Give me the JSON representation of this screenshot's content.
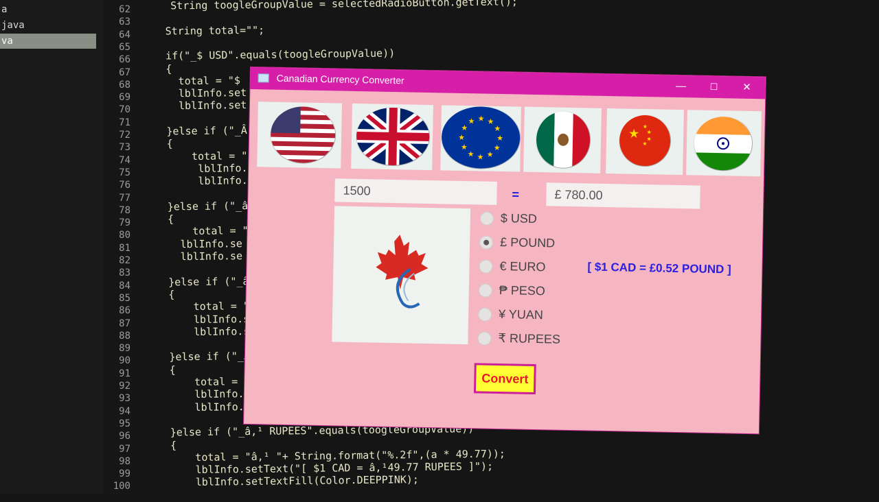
{
  "ide": {
    "files": [
      "a",
      "java",
      "va"
    ],
    "line_numbers": [
      "62",
      "63",
      "64",
      "65",
      "66",
      "67",
      "68",
      "69",
      "70",
      "71",
      "72",
      "73",
      "74",
      "75",
      "76",
      "77",
      "78",
      "79",
      "80",
      "81",
      "82",
      "83",
      "84",
      "85",
      "86",
      "87",
      "88",
      "89",
      "90",
      "91",
      "92",
      "93",
      "94",
      "95",
      "96",
      "97",
      "98",
      "99",
      "100"
    ],
    "code_lines": [
      "String toogleGroupValue = selectedRadioButton.getText();",
      "",
      "String total=\"\";",
      "",
      "if(\"_$ USD\".equals(toogleGroupValue))",
      "{",
      "  total = \"$",
      "  lblInfo.set",
      "  lblInfo.set",
      "",
      "}else if (\"_Â",
      "{",
      "    total = \"",
      "     lblInfo.",
      "     lblInfo.",
      "",
      "}else if (\"_â",
      "{",
      "    total = \"",
      "  lblInfo.se",
      "  lblInfo.se",
      "",
      "}else if (\"_â",
      "{",
      "    total = \"",
      "    lblInfo.s",
      "    lblInfo.s",
      "",
      "}else if (\"_Â",
      "{",
      "    total = \"",
      "    lblInfo.s",
      "    lblInfo.s",
      "",
      "}else if (\"_â,¹ RUPEES\".equals(toogleGroupValue))",
      "{",
      "    total = \"â,¹ \"+ String.format(\"%.2f\",(a * 49.77));",
      "    lblInfo.setText(\"[ $1 CAD = â,¹49.77 RUPEES ]\");",
      "    lblInfo.setTextFill(Color.DEEPPINK);"
    ]
  },
  "window": {
    "title": "Canadian Currency Converter",
    "controls": {
      "minimize": "—",
      "maximize": "☐",
      "close": "✕"
    }
  },
  "flags": [
    {
      "name": "flag-usa-icon",
      "color": "#b22234"
    },
    {
      "name": "flag-uk-icon",
      "color": "#012169"
    },
    {
      "name": "flag-eu-icon",
      "color": "#003399"
    },
    {
      "name": "flag-mexico-icon",
      "color": "#006847"
    },
    {
      "name": "flag-china-icon",
      "color": "#de2910"
    },
    {
      "name": "flag-india-icon",
      "color": "#ff9933"
    }
  ],
  "converter": {
    "amount_value": "1500",
    "equals": "=",
    "result_value": "£ 780.00",
    "currencies": [
      {
        "label": "$ USD",
        "selected": false
      },
      {
        "label": "£ POUND",
        "selected": true
      },
      {
        "label": "€ EURO",
        "selected": false
      },
      {
        "label": "₱ PESO",
        "selected": false
      },
      {
        "label": "¥ YUAN",
        "selected": false
      },
      {
        "label": "₹ RUPEES",
        "selected": false
      }
    ],
    "info": "[ $1 CAD = £0.52 POUND ]",
    "convert_label": "Convert"
  },
  "colors": {
    "titlebar": "#d61ea8",
    "window_bg": "#f6b6c1",
    "info_text": "#2a1ee0",
    "button_bg": "#ffff33",
    "button_text": "#e8182a"
  }
}
